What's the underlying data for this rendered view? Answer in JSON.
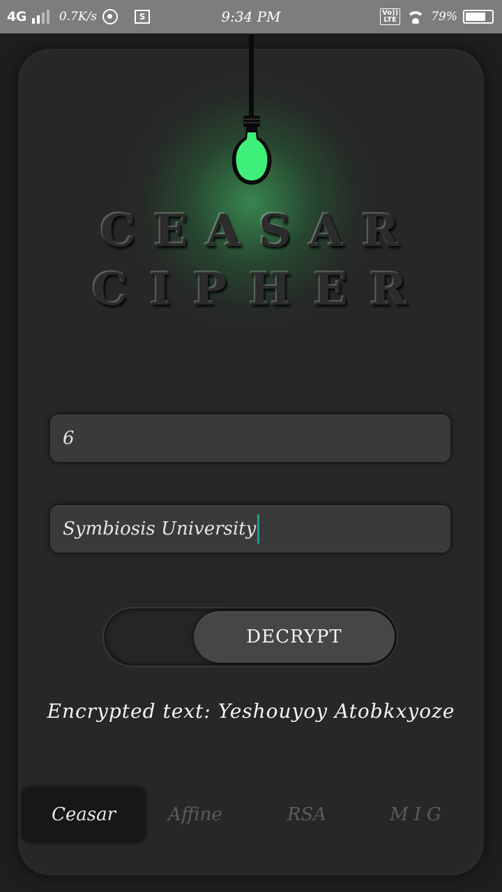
{
  "status_bar": {
    "network": "4G",
    "speed": "0.7K/s",
    "time": "9:34 PM",
    "volte": "Vo)) LTE",
    "battery_pct": "79%"
  },
  "app": {
    "title_line1": "CEASAR",
    "title_line2": "CIPHER",
    "accent_color": "#3ef07a"
  },
  "form": {
    "key_value": "6",
    "text_value": "Symbiosis University",
    "toggle_label": "DECRYPT",
    "result_text": "Encrypted text: Yeshouyoy Atobkxyoze"
  },
  "tabs": [
    {
      "label": "Ceasar",
      "active": true
    },
    {
      "label": "Affine",
      "active": false
    },
    {
      "label": "RSA",
      "active": false
    },
    {
      "label": "MIG",
      "active": false
    }
  ]
}
